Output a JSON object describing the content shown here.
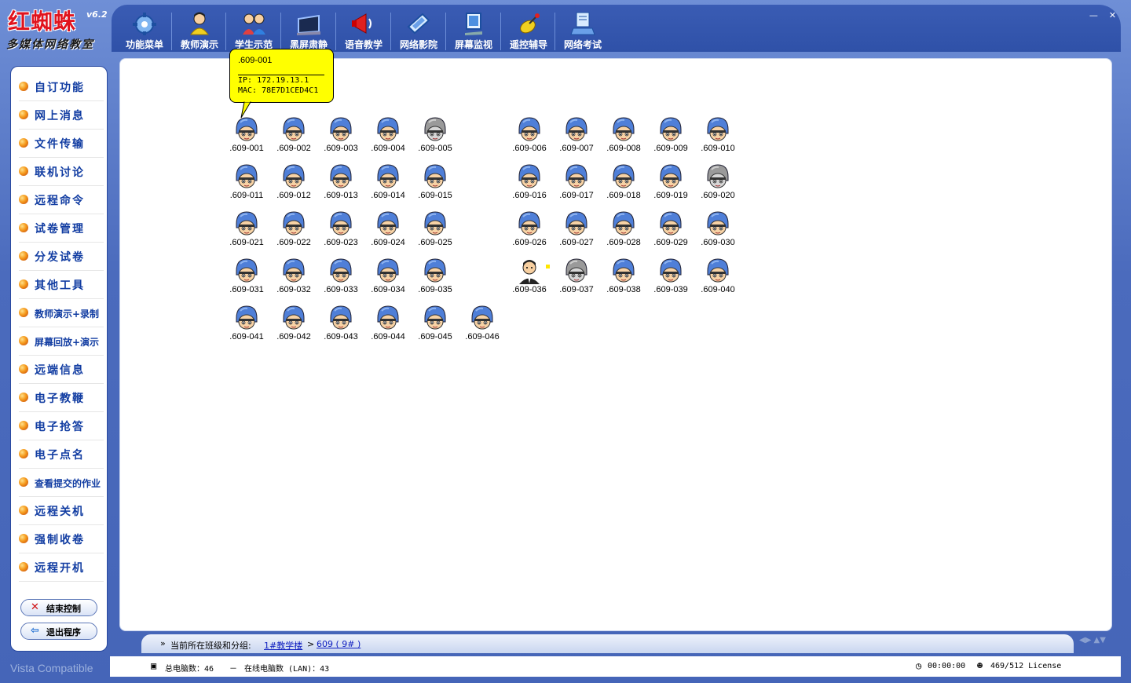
{
  "app": {
    "title": "红蜘蛛",
    "version": "v6.2",
    "subtitle": "多媒体网络教室"
  },
  "toolbar": [
    {
      "label": "功能菜单",
      "icon": "gear-icon"
    },
    {
      "label": "教师演示",
      "icon": "teacher-icon"
    },
    {
      "label": "学生示范",
      "icon": "students-icon"
    },
    {
      "label": "黑屏肃静",
      "icon": "black-screen-icon"
    },
    {
      "label": "语音教学",
      "icon": "megaphone-icon"
    },
    {
      "label": "网络影院",
      "icon": "film-icon"
    },
    {
      "label": "屏幕监视",
      "icon": "monitor-icon"
    },
    {
      "label": "遥控辅导",
      "icon": "satellite-icon"
    },
    {
      "label": "网络考试",
      "icon": "exam-icon"
    }
  ],
  "sidebar": {
    "items": [
      {
        "label": "自订功能"
      },
      {
        "label": "网上消息"
      },
      {
        "label": "文件传输"
      },
      {
        "label": "联机讨论"
      },
      {
        "label": "远程命令"
      },
      {
        "label": "试卷管理"
      },
      {
        "label": "分发试卷"
      },
      {
        "label": "其他工具"
      },
      {
        "label": "教师演示+录制"
      },
      {
        "label": "屏幕回放+演示"
      },
      {
        "label": "远端信息"
      },
      {
        "label": "电子教鞭"
      },
      {
        "label": "电子抢答"
      },
      {
        "label": "电子点名"
      },
      {
        "label": "查看提交的作业"
      },
      {
        "label": "远程关机"
      },
      {
        "label": "强制收卷"
      },
      {
        "label": "远程开机"
      }
    ],
    "end_control": "结束控制",
    "exit_program": "退出程序",
    "vista": "Vista Compatible"
  },
  "tooltip": {
    "name": ".609-001",
    "ip": "IP: 172.19.13.1",
    "mac": "MAC: 78E7D1CED4C1"
  },
  "computers": [
    {
      "label": ".609-001",
      "state": "online"
    },
    {
      "label": ".609-002",
      "state": "online"
    },
    {
      "label": ".609-003",
      "state": "online"
    },
    {
      "label": ".609-004",
      "state": "online"
    },
    {
      "label": ".609-005",
      "state": "offline"
    },
    {
      "label": ".609-006",
      "state": "online"
    },
    {
      "label": ".609-007",
      "state": "online"
    },
    {
      "label": ".609-008",
      "state": "online"
    },
    {
      "label": ".609-009",
      "state": "online"
    },
    {
      "label": ".609-010",
      "state": "online"
    },
    {
      "label": ".609-011",
      "state": "online"
    },
    {
      "label": ".609-012",
      "state": "online"
    },
    {
      "label": ".609-013",
      "state": "online"
    },
    {
      "label": ".609-014",
      "state": "online"
    },
    {
      "label": ".609-015",
      "state": "online"
    },
    {
      "label": ".609-016",
      "state": "online"
    },
    {
      "label": ".609-017",
      "state": "online"
    },
    {
      "label": ".609-018",
      "state": "online"
    },
    {
      "label": ".609-019",
      "state": "online"
    },
    {
      "label": ".609-020",
      "state": "offline"
    },
    {
      "label": ".609-021",
      "state": "online"
    },
    {
      "label": ".609-022",
      "state": "online"
    },
    {
      "label": ".609-023",
      "state": "online"
    },
    {
      "label": ".609-024",
      "state": "online"
    },
    {
      "label": ".609-025",
      "state": "online"
    },
    {
      "label": ".609-026",
      "state": "online"
    },
    {
      "label": ".609-027",
      "state": "online"
    },
    {
      "label": ".609-028",
      "state": "online"
    },
    {
      "label": ".609-029",
      "state": "online"
    },
    {
      "label": ".609-030",
      "state": "online"
    },
    {
      "label": ".609-031",
      "state": "online"
    },
    {
      "label": ".609-032",
      "state": "online"
    },
    {
      "label": ".609-033",
      "state": "online"
    },
    {
      "label": ".609-034",
      "state": "online"
    },
    {
      "label": ".609-035",
      "state": "online"
    },
    {
      "label": ".609-036",
      "state": "teacher"
    },
    {
      "label": ".609-037",
      "state": "offline"
    },
    {
      "label": ".609-038",
      "state": "online"
    },
    {
      "label": ".609-039",
      "state": "online"
    },
    {
      "label": ".609-040",
      "state": "online"
    },
    {
      "label": ".609-041",
      "state": "online"
    },
    {
      "label": ".609-042",
      "state": "online"
    },
    {
      "label": ".609-043",
      "state": "online"
    },
    {
      "label": ".609-044",
      "state": "online"
    },
    {
      "label": ".609-045",
      "state": "online"
    },
    {
      "label": ".609-046",
      "state": "online"
    }
  ],
  "breadcrumb": {
    "arrows": "»",
    "label": "当前所在班级和分组:",
    "building": "1#教学楼",
    "separator": ">",
    "room": "609 ( 9# )"
  },
  "status": {
    "total": "总电脑数：46",
    "dash": "－",
    "online": "在线电脑数 (LAN)：43",
    "time": "00:00:00",
    "license": "469/512 License"
  },
  "colors": {
    "frame": "#4d6fc0",
    "toolbar": "#3355ad",
    "sidebar_text": "#123da2",
    "tooltip_bg": "#ffff00",
    "link": "#1020c0"
  }
}
